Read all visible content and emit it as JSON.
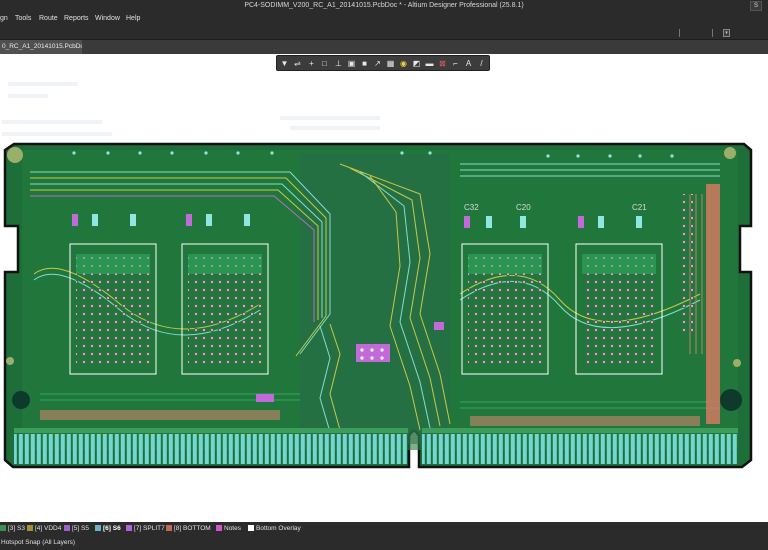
{
  "window": {
    "title": "PC4-SODIMM_V200_RC_A1_20141015.PcbDoc * - Altium Designer Professional (25.8.1)"
  },
  "menu": {
    "items": [
      "gn",
      "Tools",
      "Route",
      "Reports",
      "Window",
      "Help"
    ]
  },
  "document_tab": {
    "label": "0_RC_A1_20141015.PcbDoc *"
  },
  "active_bar": {
    "tools": [
      {
        "icon": "filter-icon",
        "glyph": "▼"
      },
      {
        "icon": "interactive-route-icon",
        "glyph": "⇌"
      },
      {
        "icon": "place-component-icon",
        "glyph": "+"
      },
      {
        "icon": "select-rectangle-icon",
        "glyph": "□"
      },
      {
        "icon": "align-icon",
        "glyph": "⊥"
      },
      {
        "icon": "place-pad-icon",
        "glyph": "▣"
      },
      {
        "icon": "fill-icon",
        "glyph": "■"
      },
      {
        "icon": "line-icon",
        "glyph": "↗"
      },
      {
        "icon": "polygon-pour-icon",
        "glyph": "▦"
      },
      {
        "icon": "bulb-highlight-icon",
        "glyph": "◉"
      },
      {
        "icon": "measure-icon",
        "glyph": "◩"
      },
      {
        "icon": "region-icon",
        "glyph": "▬"
      },
      {
        "icon": "keepout-icon",
        "glyph": "⊠"
      },
      {
        "icon": "dimension-icon",
        "glyph": "⌐"
      },
      {
        "icon": "text-icon",
        "glyph": "A"
      },
      {
        "icon": "arc-icon",
        "glyph": "/"
      }
    ]
  },
  "board": {
    "designators": [
      "C32",
      "C20",
      "C21"
    ],
    "colors": {
      "copper_top": "#1e7a3c",
      "copper_inner": "#2fae63",
      "trace_yellow": "#d9d24a",
      "trace_cyan": "#8fe8e0",
      "trace_purple": "#c26bd8",
      "gold_finger": "#73d6d0",
      "outline": "#111111"
    }
  },
  "layers": [
    {
      "label": "[3] S3",
      "color": "#3d8e4f",
      "active": false
    },
    {
      "label": "[4] VDD4",
      "color": "#a58d3b",
      "active": false
    },
    {
      "label": "[5] S5",
      "color": "#9a63c6",
      "active": false
    },
    {
      "label": "[6] S6",
      "color": "#6fb0c9",
      "active": true
    },
    {
      "label": "[7] SPLIT7",
      "color": "#b164d4",
      "active": false
    },
    {
      "label": "[8] BOTTOM",
      "color": "#c06a52",
      "active": false
    },
    {
      "label": "Notes",
      "color": "#cc55cc",
      "active": false
    },
    {
      "label": "Bottom Overlay",
      "color": "#ffffff",
      "active": false
    }
  ],
  "status": {
    "text": "Hotspot Snap (All Layers)"
  }
}
